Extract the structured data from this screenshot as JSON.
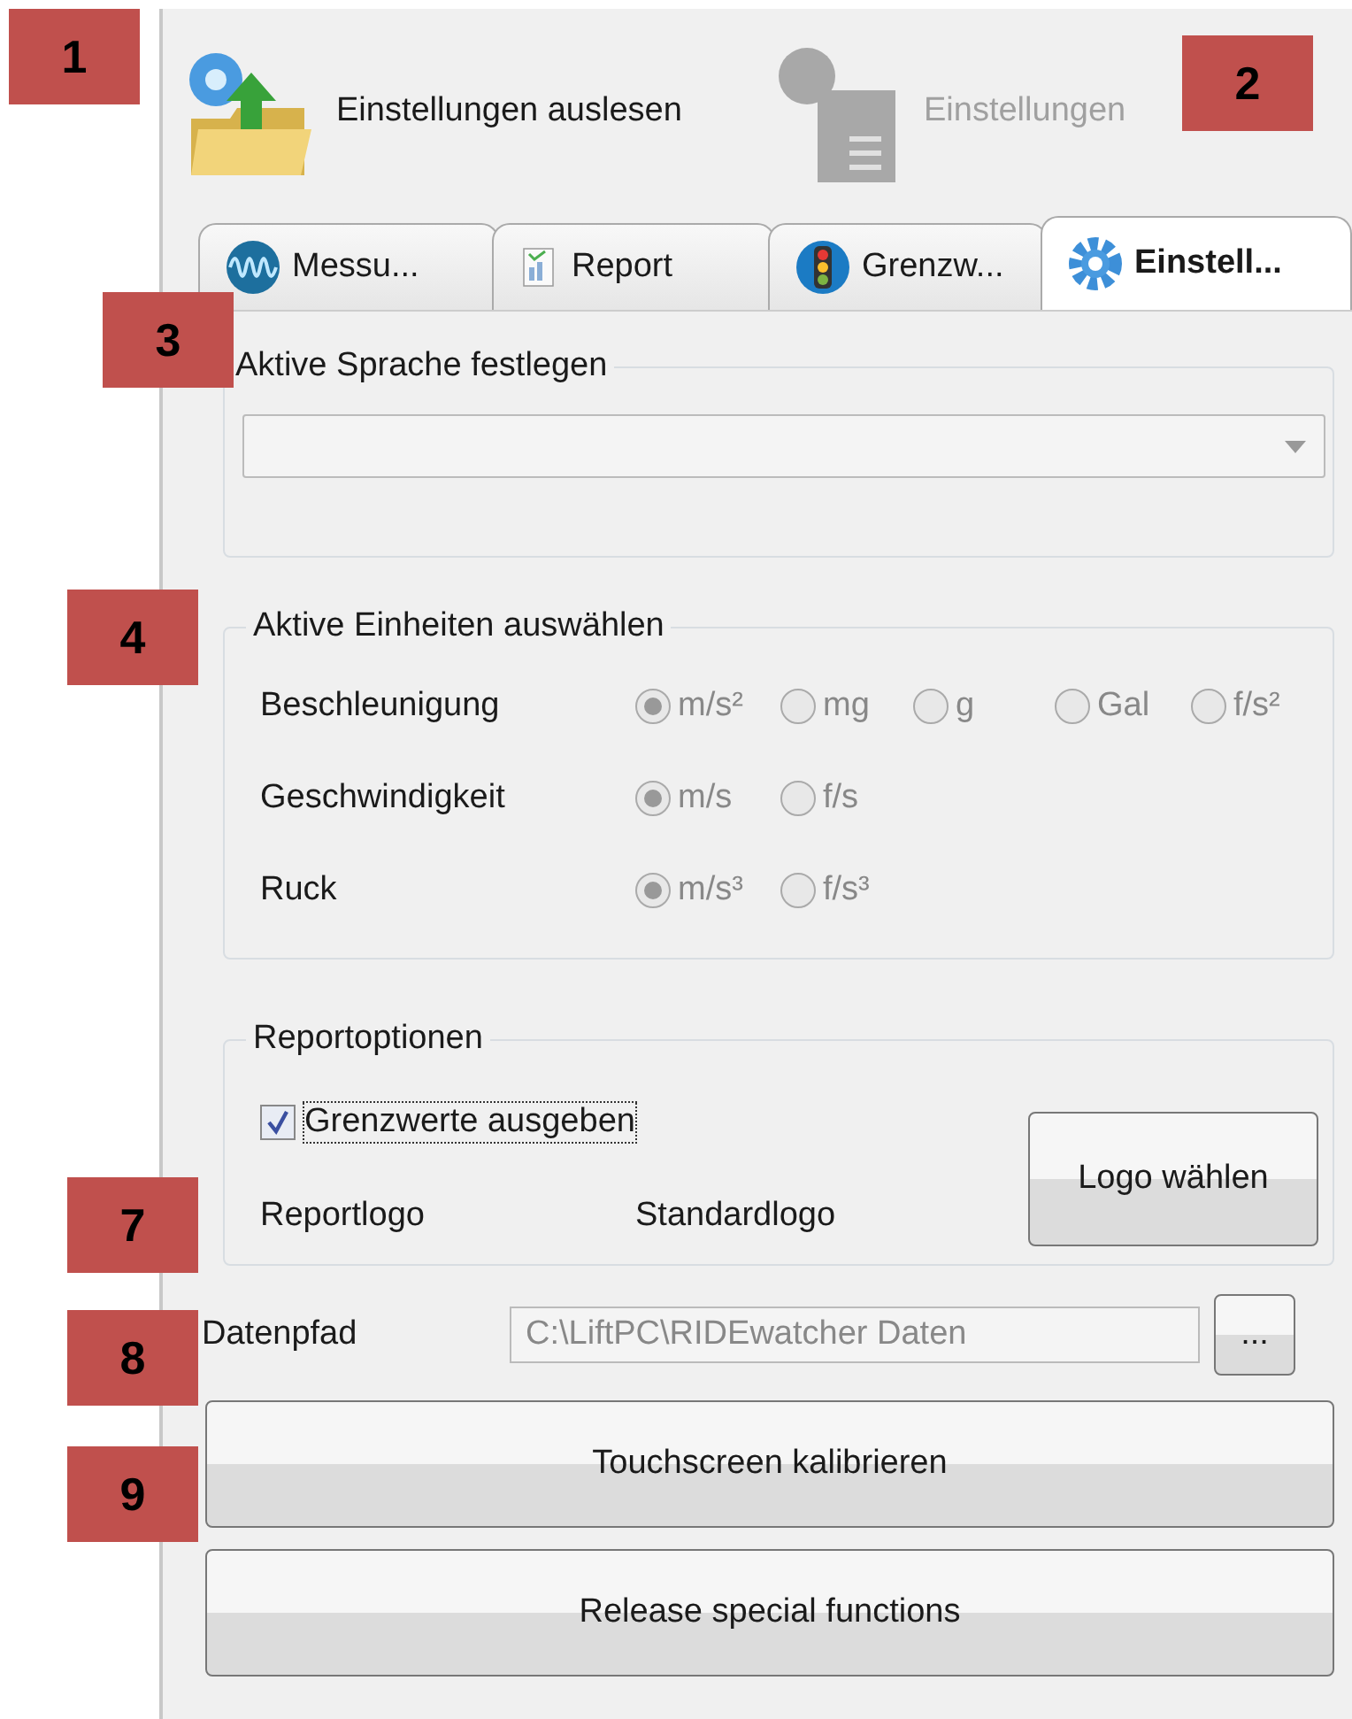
{
  "toolbar": [
    {
      "label": "Einstellungen auslesen",
      "disabled": false,
      "kind": "load"
    },
    {
      "label": "Einstellungen",
      "disabled": true,
      "kind": "save"
    }
  ],
  "tabs": [
    {
      "label": "Messu...",
      "selected": false,
      "kind": "wave"
    },
    {
      "label": "Report",
      "selected": false,
      "kind": "report"
    },
    {
      "label": "Grenzw...",
      "selected": false,
      "kind": "light"
    },
    {
      "label": "Einstell...",
      "selected": true,
      "kind": "gear"
    }
  ],
  "language_group": {
    "title": "Aktive Sprache festlegen"
  },
  "units_group": {
    "title": "Aktive Einheiten auswählen",
    "disabled": true,
    "rows": [
      {
        "label": "Beschleunigung",
        "options": [
          {
            "label": "m/s²",
            "selected": true
          },
          {
            "label": "mg",
            "selected": false
          },
          {
            "label": "g",
            "selected": false
          },
          {
            "label": "Gal",
            "selected": false
          },
          {
            "label": "f/s²",
            "selected": false
          }
        ]
      },
      {
        "label": "Geschwindigkeit",
        "options": [
          {
            "label": "m/s",
            "selected": true
          },
          {
            "label": "f/s",
            "selected": false
          }
        ]
      },
      {
        "label": "Ruck",
        "options": [
          {
            "label": "m/s³",
            "selected": true
          },
          {
            "label": "f/s³",
            "selected": false
          }
        ]
      }
    ]
  },
  "report_group": {
    "title": "Reportoptionen",
    "checkbox": {
      "label": "Grenzwerte ausgeben",
      "checked": true
    },
    "logo_label": "Reportlogo",
    "logo_value": "Standardlogo",
    "logo_button": "Logo wählen"
  },
  "data_path": {
    "label": "Datenpfad",
    "value": "C:\\LiftPC\\RIDEwatcher Daten",
    "disabled": true,
    "browse_button": "..."
  },
  "buttons": [
    "Touchscreen kalibrieren",
    "Release special functions"
  ],
  "annotations": [
    "1",
    "2",
    "3",
    "4",
    "7",
    "8",
    "9"
  ]
}
